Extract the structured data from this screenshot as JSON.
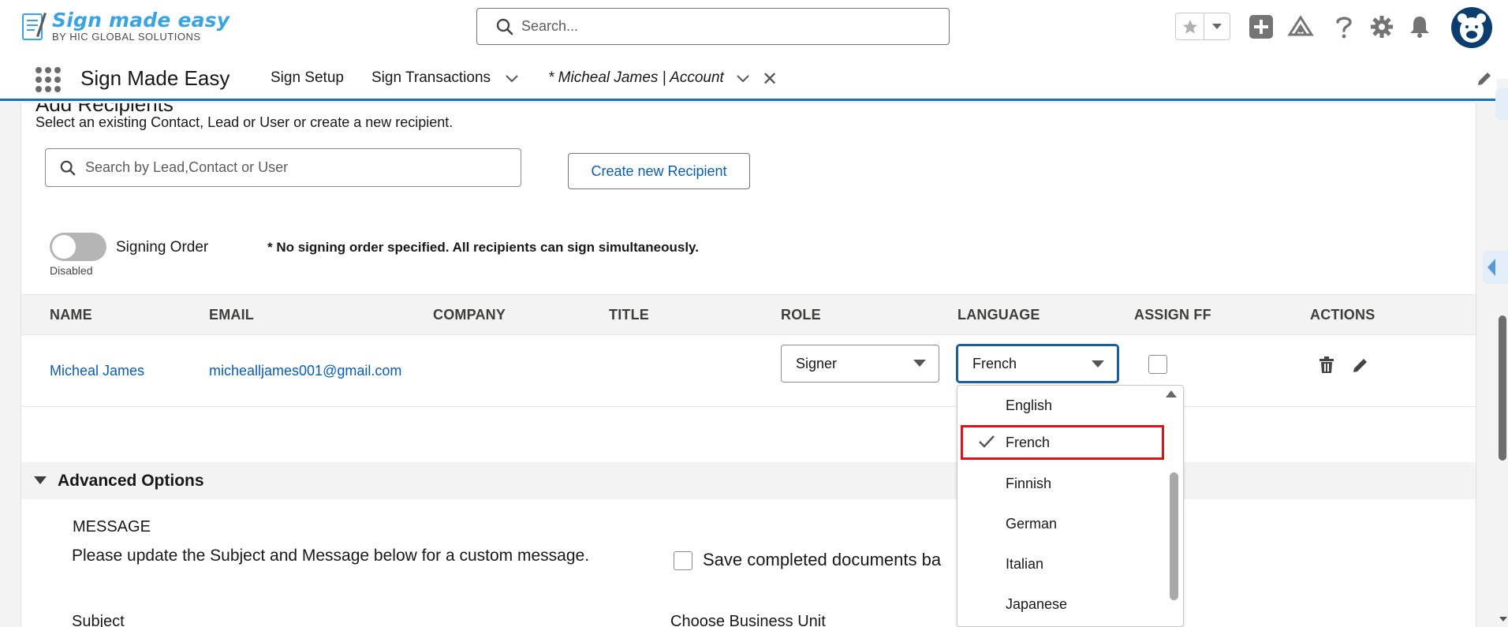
{
  "header": {
    "logo_main": "Sign made easy",
    "logo_sub": "BY HIC GLOBAL SOLUTIONS",
    "search_placeholder": "Search..."
  },
  "nav": {
    "app_name": "Sign Made Easy",
    "items": [
      {
        "label": "Sign Setup"
      },
      {
        "label": "Sign Transactions"
      }
    ],
    "active_tab": "* Micheal James | Account"
  },
  "recipients": {
    "section_title": "Add Recipients",
    "description": "Select an existing Contact, Lead or User or create a new recipient.",
    "search_placeholder": "Search by Lead,Contact or User",
    "create_button": "Create new Recipient",
    "signing_order_label": "Signing Order",
    "signing_order_state": "Disabled",
    "order_note": "* No signing order specified. All recipients can sign simultaneously."
  },
  "table": {
    "headers": [
      "NAME",
      "EMAIL",
      "COMPANY",
      "TITLE",
      "ROLE",
      "LANGUAGE",
      "ASSIGN FF",
      "ACTIONS"
    ],
    "rows": [
      {
        "name": "Micheal James",
        "email": "michealljames001@gmail.com",
        "company": "",
        "title": "",
        "role": "Signer",
        "language": "French",
        "assign_ff": false
      }
    ]
  },
  "language_dropdown": {
    "options": [
      "English",
      "French",
      "Finnish",
      "German",
      "Italian",
      "Japanese"
    ],
    "selected": "French"
  },
  "advanced": {
    "title": "Advanced Options",
    "message_label": "MESSAGE",
    "message_text": "Please update the Subject and Message below for a custom message.",
    "save_label": "Save completed documents ba",
    "subject_label": "Subject",
    "business_unit_label": "Choose Business Unit"
  },
  "colors": {
    "brand_blue": "#1b6fb5",
    "link": "#0b5cab",
    "highlight": "#d8141c",
    "logo": "#3aa3e0"
  }
}
